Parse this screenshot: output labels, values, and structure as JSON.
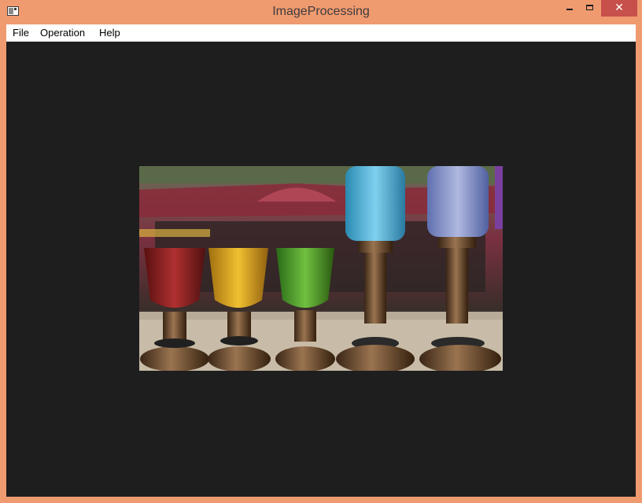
{
  "window": {
    "title": "ImageProcessing",
    "frame_color": "#f09a70",
    "close_button_color": "#c7504b",
    "icons": {
      "app": "app-window-icon",
      "minimize": "minimize-icon",
      "maximize": "maximize-icon",
      "close": "close-icon"
    }
  },
  "menubar": {
    "items": [
      {
        "label": "File"
      },
      {
        "label": "Operation"
      },
      {
        "label": "Help"
      }
    ]
  },
  "canvas": {
    "background": "#1e1e1e"
  }
}
